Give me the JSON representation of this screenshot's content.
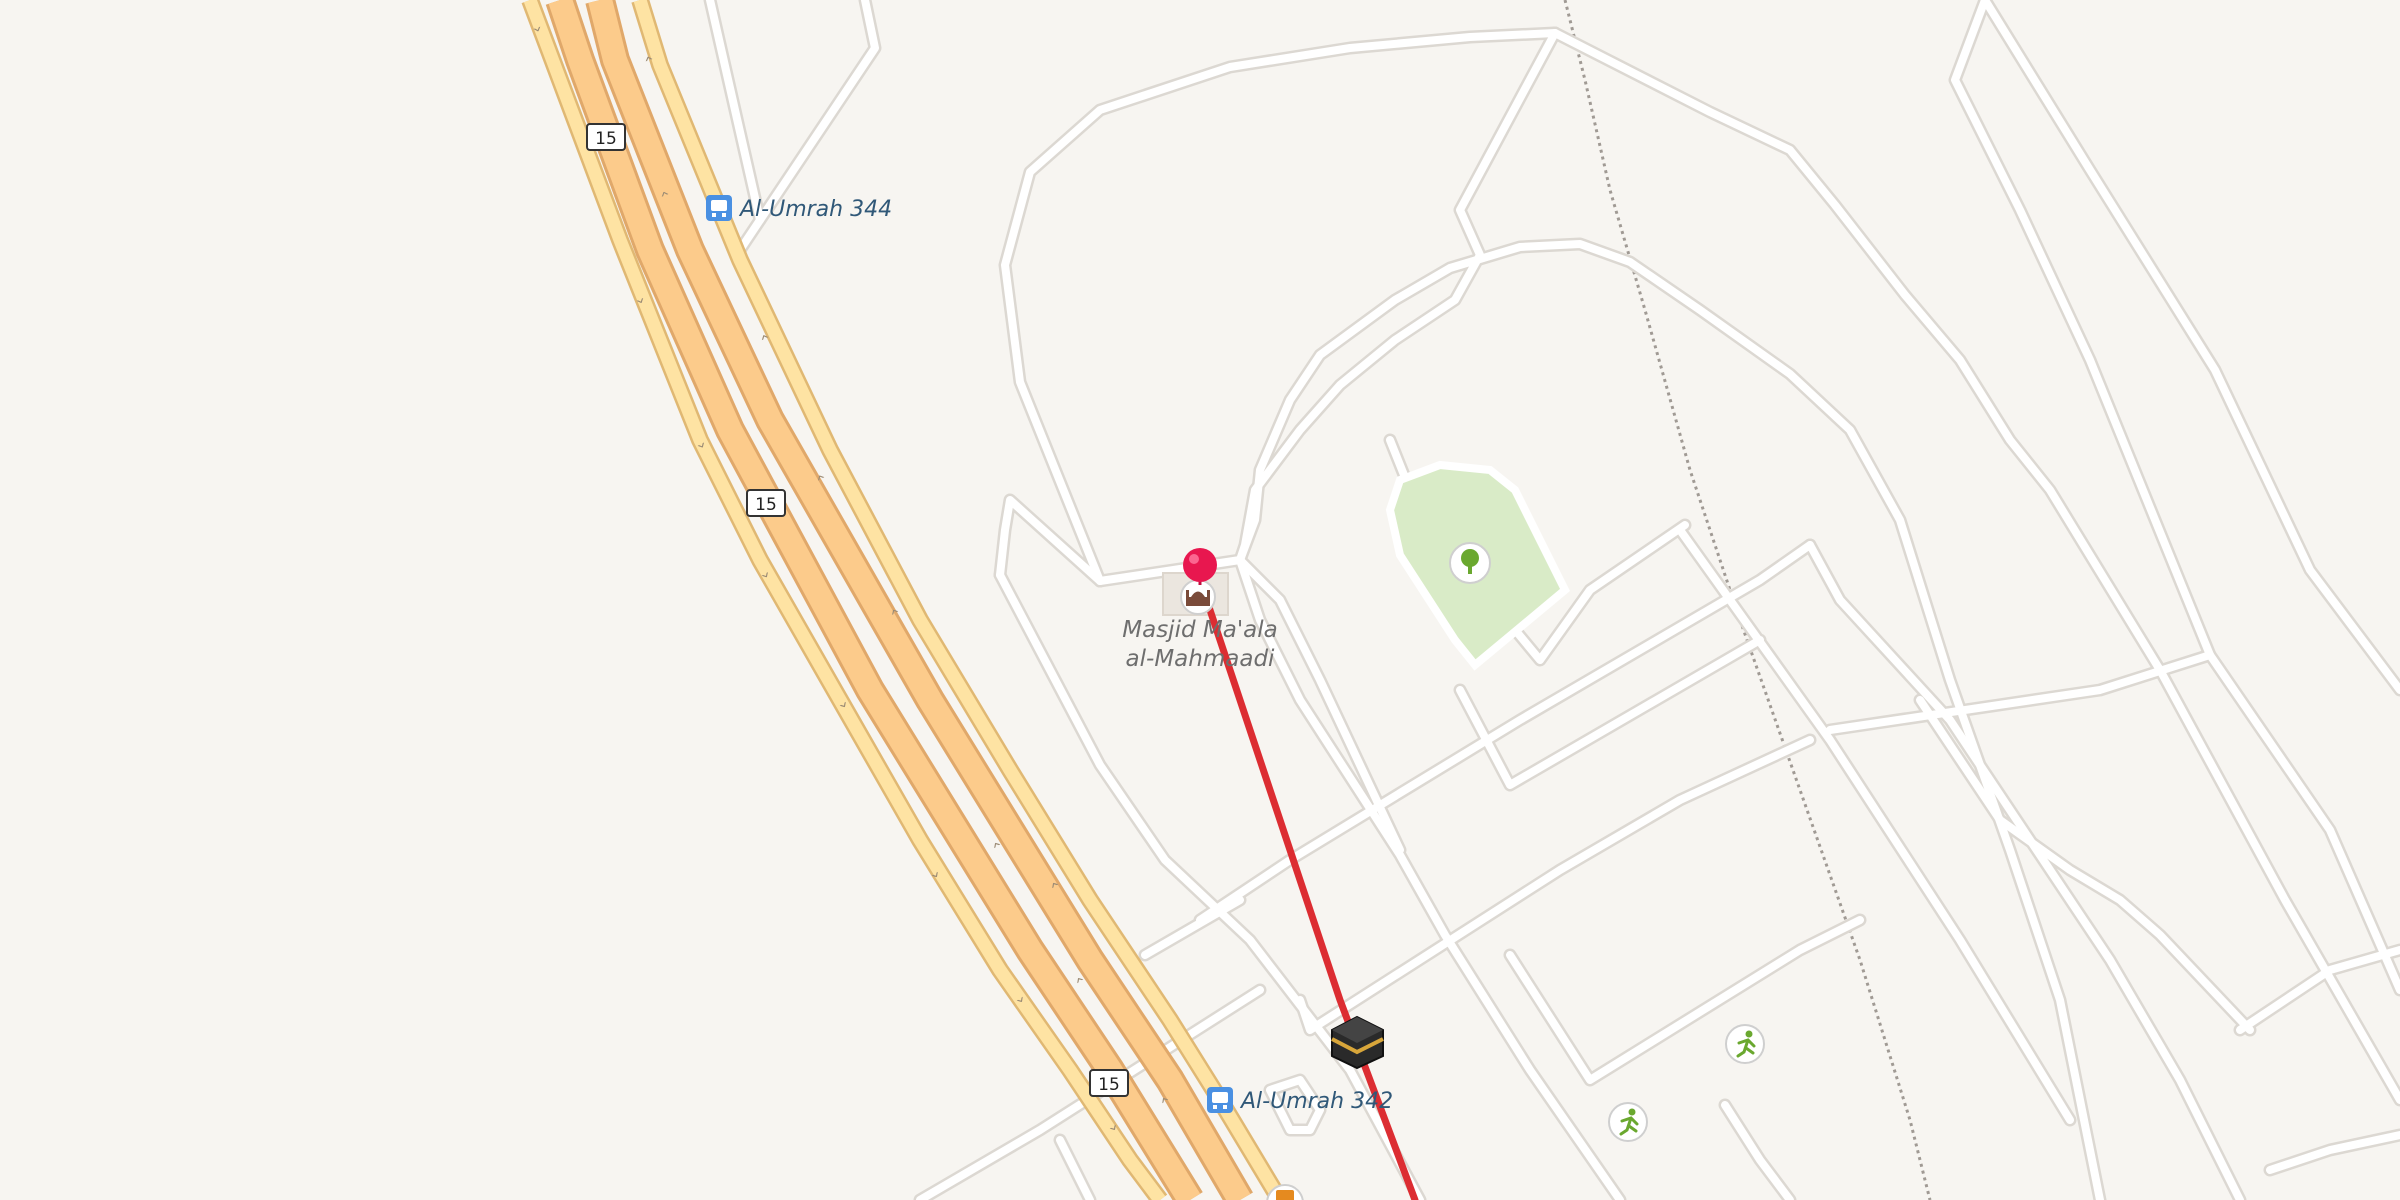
{
  "map": {
    "background": "#f7f5f1",
    "road_color": "#ffffff",
    "road_casing": "#dcd8d2",
    "highway_fill": "#fccb8b",
    "highway_casing": "#e0a86a",
    "highway_link_fill": "#fee3a3",
    "park_fill": "#d9ebc7",
    "route_color": "#dc2d32",
    "pin_color": "#e8174f",
    "transit_color": "#4a90e2",
    "poi_label_color": "#6e6e6e"
  },
  "route_shields": [
    {
      "label": "15"
    },
    {
      "label": "15"
    },
    {
      "label": "15"
    }
  ],
  "bus_stops": [
    {
      "label": "Al-Umrah 344",
      "icon": "bus-icon"
    },
    {
      "label": "Al-Umrah 342",
      "icon": "bus-icon"
    }
  ],
  "poi": {
    "name_line1": "Masjid Ma'ala",
    "name_line2": "al-Mahmaadi",
    "icon": "mosque-icon"
  },
  "markers": {
    "pin_icon": "location-pin-icon",
    "kaaba_icon": "kaaba-icon",
    "park_icon": "tree-icon",
    "sport_icon": "running-person-icon"
  }
}
